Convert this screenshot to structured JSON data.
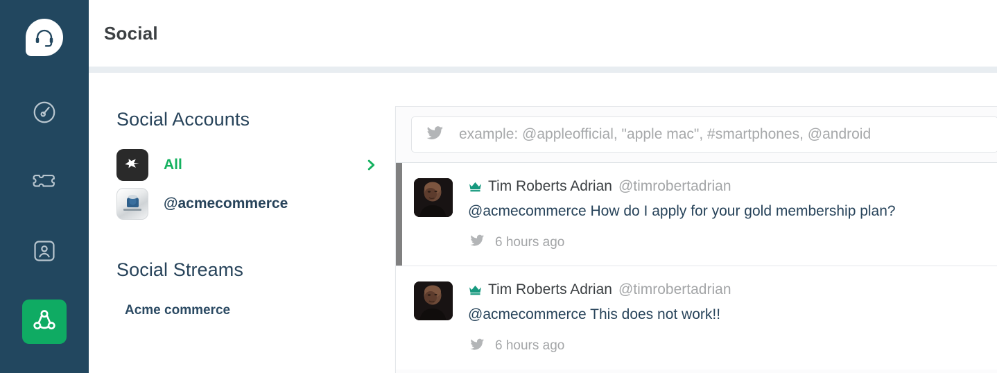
{
  "rail": {
    "logo": {
      "icon": "headset-icon",
      "name": "brand-logo"
    },
    "items": [
      {
        "icon": "gauge-icon",
        "name": "dashboard"
      },
      {
        "icon": "ticket-icon",
        "name": "tickets"
      },
      {
        "icon": "contact-card-icon",
        "name": "contacts"
      },
      {
        "icon": "share-network-icon",
        "name": "social",
        "active": true
      }
    ],
    "bg": "#22475f",
    "active_bg": "#0fab63"
  },
  "header": {
    "title": "Social"
  },
  "accounts": {
    "heading": "Social Accounts",
    "items": [
      {
        "label": "All",
        "icon": "all-accounts-icon",
        "color": "#14b15f",
        "chevron": "chevron-right-icon"
      },
      {
        "label": "@acmecommerce",
        "icon": "acmecommerce-avatar",
        "color": "#27435a"
      }
    ]
  },
  "streams": {
    "heading": "Social Streams",
    "items": [
      {
        "label": "Acme commerce"
      }
    ]
  },
  "search": {
    "icon": "twitter-bird-icon",
    "value": "",
    "placeholder": "example: @appleofficial, \"apple mac\", #smartphones, @android"
  },
  "feed": [
    {
      "avatar": "user-photo",
      "badge": "crown-icon",
      "name": "Tim Roberts Adrian",
      "handle": "@timrobertadrian",
      "text": "@acmecommerce How do I apply for your gold membership plan?",
      "source_icon": "twitter-bird-icon",
      "time": "6 hours ago",
      "selected": true
    },
    {
      "avatar": "user-photo",
      "badge": "crown-icon",
      "name": "Tim Roberts Adrian",
      "handle": "@timrobertadrian",
      "text": "@acmecommerce This does not work!!",
      "source_icon": "twitter-bird-icon",
      "time": "6 hours ago",
      "selected": false
    }
  ],
  "colors": {
    "sidebar": "#22475f",
    "accent_green": "#0fab63",
    "link_green": "#14b15f",
    "navy_text": "#27435a",
    "muted": "#a3a5a7",
    "crown": "#17997f"
  }
}
